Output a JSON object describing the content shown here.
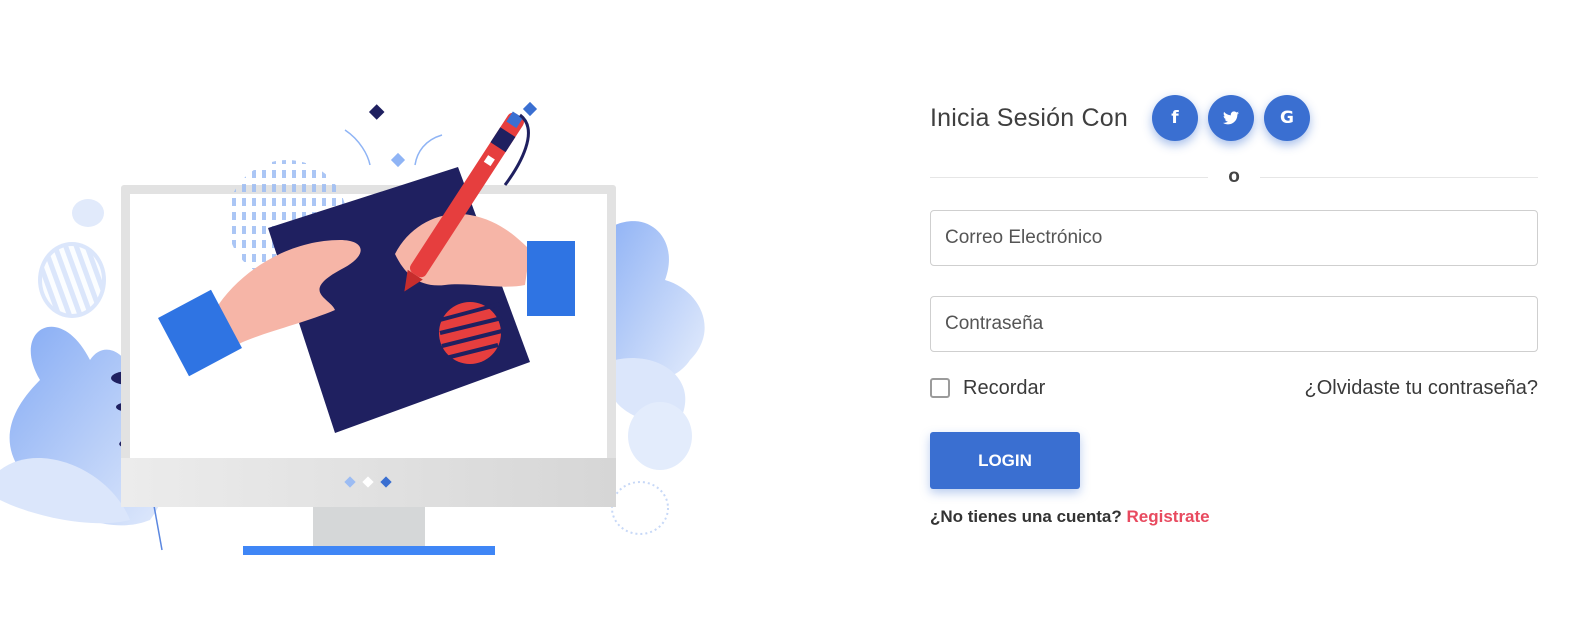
{
  "social": {
    "title": "Inicia Sesión Con",
    "buttons": [
      {
        "icon": "facebook-icon",
        "glyph": "f"
      },
      {
        "icon": "twitter-icon",
        "glyph": "❧"
      },
      {
        "icon": "google-icon",
        "glyph": "G"
      }
    ]
  },
  "divider_text": "o",
  "form": {
    "email_placeholder": "Correo Electrónico",
    "password_placeholder": "Contraseña",
    "remember_label": "Recordar",
    "forgot_label": "¿Olvidaste tu contraseña?",
    "login_label": "LOGIN",
    "no_account_text": "¿No tienes una cuenta?",
    "register_label": "Registrate"
  },
  "colors": {
    "primary": "#3a6fd1",
    "accent_red": "#e84a5f",
    "navy": "#1f2060",
    "light_blue": "#8fb4f5"
  }
}
